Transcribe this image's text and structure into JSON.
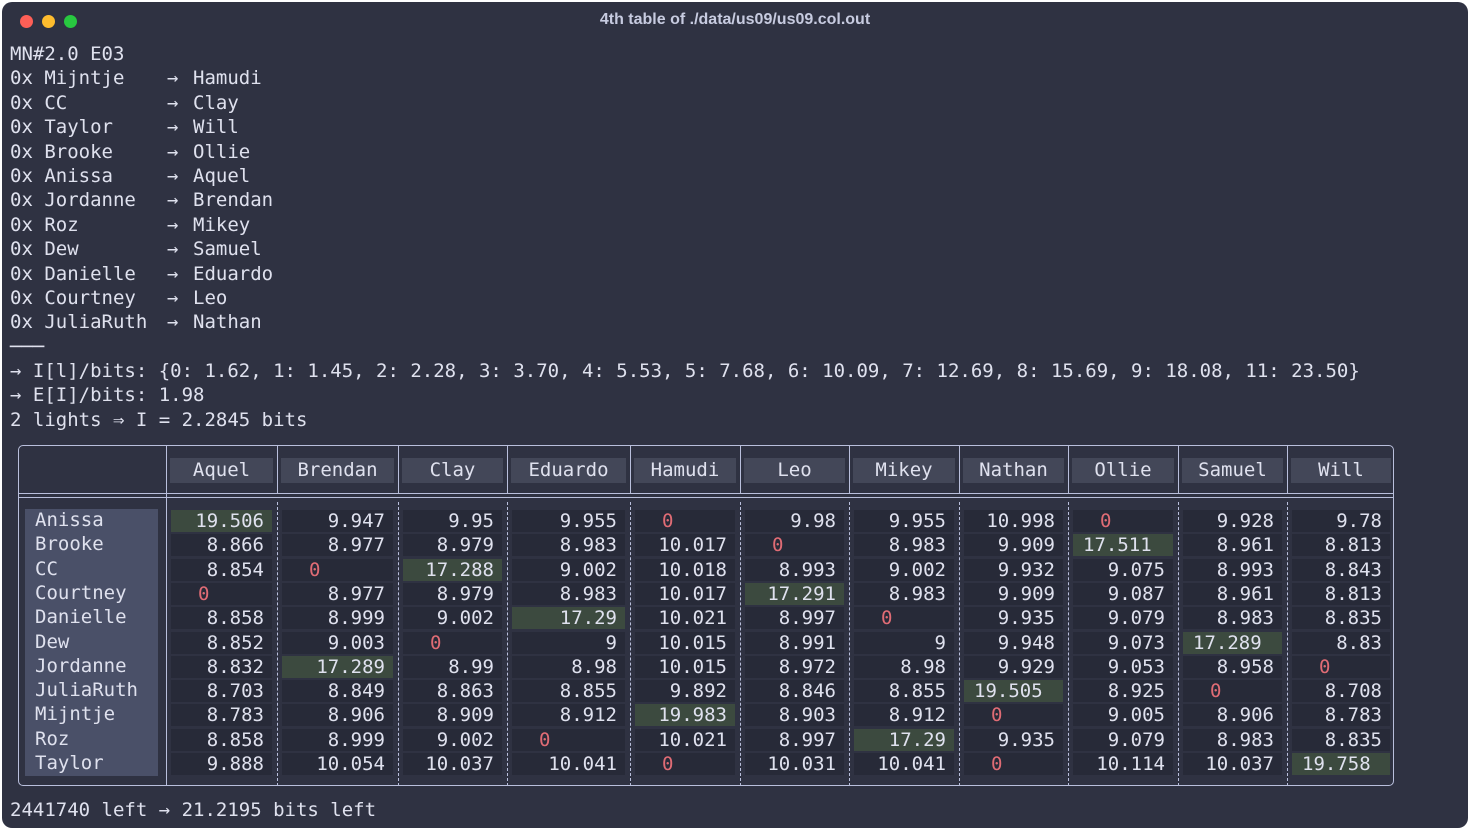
{
  "window": {
    "title": "4th table of ./data/us09/us09.col.out"
  },
  "header_line": "MN#2.0 E03",
  "mappings": [
    {
      "src": "0x Mijntje",
      "arrow": "→",
      "dst": "Hamudi"
    },
    {
      "src": "0x CC",
      "arrow": "→",
      "dst": "Clay"
    },
    {
      "src": "0x Taylor",
      "arrow": "→",
      "dst": "Will"
    },
    {
      "src": "0x Brooke",
      "arrow": "→",
      "dst": "Ollie"
    },
    {
      "src": "0x Anissa",
      "arrow": "→",
      "dst": "Aquel"
    },
    {
      "src": "0x Jordanne",
      "arrow": "→",
      "dst": "Brendan"
    },
    {
      "src": "0x Roz",
      "arrow": "→",
      "dst": "Mikey"
    },
    {
      "src": "0x Dew",
      "arrow": "→",
      "dst": "Samuel"
    },
    {
      "src": "0x Danielle",
      "arrow": "→",
      "dst": "Eduardo"
    },
    {
      "src": "0x Courtney",
      "arrow": "→",
      "dst": "Leo"
    },
    {
      "src": "0x JuliaRuth",
      "arrow": "→",
      "dst": "Nathan"
    }
  ],
  "separator": "───",
  "info_lines": [
    "→ I[l]/bits: {0: 1.62, 1: 1.45, 2: 2.28, 3: 3.70, 4: 5.53, 5: 7.68, 6: 10.09, 7: 12.69, 8: 15.69, 9: 18.08, 11: 23.50}",
    "→ E[I]/bits: 1.98",
    "2 lights ⇒ I = 2.2845 bits"
  ],
  "table": {
    "columns": [
      "Aquel",
      "Brendan",
      "Clay",
      "Eduardo",
      "Hamudi",
      "Leo",
      "Mikey",
      "Nathan",
      "Ollie",
      "Samuel",
      "Will"
    ],
    "rows": [
      {
        "name": "Anissa",
        "values": [
          "19.506",
          "9.947",
          "9.95",
          "9.955",
          "0",
          "9.98",
          "9.955",
          "10.998",
          "0",
          "9.928",
          "9.78"
        ],
        "highlight": 0
      },
      {
        "name": "Brooke",
        "values": [
          "8.866",
          "8.977",
          "8.979",
          "8.983",
          "10.017",
          "0",
          "8.983",
          "9.909",
          "17.511",
          "8.961",
          "8.813"
        ],
        "highlight": 8
      },
      {
        "name": "CC",
        "values": [
          "8.854",
          "0",
          "17.288",
          "9.002",
          "10.018",
          "8.993",
          "9.002",
          "9.932",
          "9.075",
          "8.993",
          "8.843"
        ],
        "highlight": 2
      },
      {
        "name": "Courtney",
        "values": [
          "0",
          "8.977",
          "8.979",
          "8.983",
          "10.017",
          "17.291",
          "8.983",
          "9.909",
          "9.087",
          "8.961",
          "8.813"
        ],
        "highlight": 5
      },
      {
        "name": "Danielle",
        "values": [
          "8.858",
          "8.999",
          "9.002",
          "17.29",
          "10.021",
          "8.997",
          "0",
          "9.935",
          "9.079",
          "8.983",
          "8.835"
        ],
        "highlight": 3
      },
      {
        "name": "Dew",
        "values": [
          "8.852",
          "9.003",
          "0",
          "9",
          "10.015",
          "8.991",
          "9",
          "9.948",
          "9.073",
          "17.289",
          "8.83"
        ],
        "highlight": 9
      },
      {
        "name": "Jordanne",
        "values": [
          "8.832",
          "17.289",
          "8.99",
          "8.98",
          "10.015",
          "8.972",
          "8.98",
          "9.929",
          "9.053",
          "8.958",
          "0"
        ],
        "highlight": 1
      },
      {
        "name": "JuliaRuth",
        "values": [
          "8.703",
          "8.849",
          "8.863",
          "8.855",
          "9.892",
          "8.846",
          "8.855",
          "19.505",
          "8.925",
          "0",
          "8.708"
        ],
        "highlight": 7
      },
      {
        "name": "Mijntje",
        "values": [
          "8.783",
          "8.906",
          "8.909",
          "8.912",
          "19.983",
          "8.903",
          "8.912",
          "0",
          "9.005",
          "8.906",
          "8.783"
        ],
        "highlight": 4
      },
      {
        "name": "Roz",
        "values": [
          "8.858",
          "8.999",
          "9.002",
          "0",
          "10.021",
          "8.997",
          "17.29",
          "9.935",
          "9.079",
          "8.983",
          "8.835"
        ],
        "highlight": 6
      },
      {
        "name": "Taylor",
        "values": [
          "9.888",
          "10.054",
          "10.037",
          "10.041",
          "0",
          "10.031",
          "10.041",
          "0",
          "10.114",
          "10.037",
          "19.758"
        ],
        "highlight": 10
      }
    ]
  },
  "footer": "2441740 left → 21.2195 bits left",
  "colors": {
    "background": "#2f3242",
    "text": "#dfe1ee",
    "cell_bg": "#272a38",
    "highlight_bg": "#3c4a3f",
    "zero": "#e06c75",
    "header_bg": "#434758",
    "row_label_bg": "#4a5068",
    "border": "#b9bfdc"
  }
}
